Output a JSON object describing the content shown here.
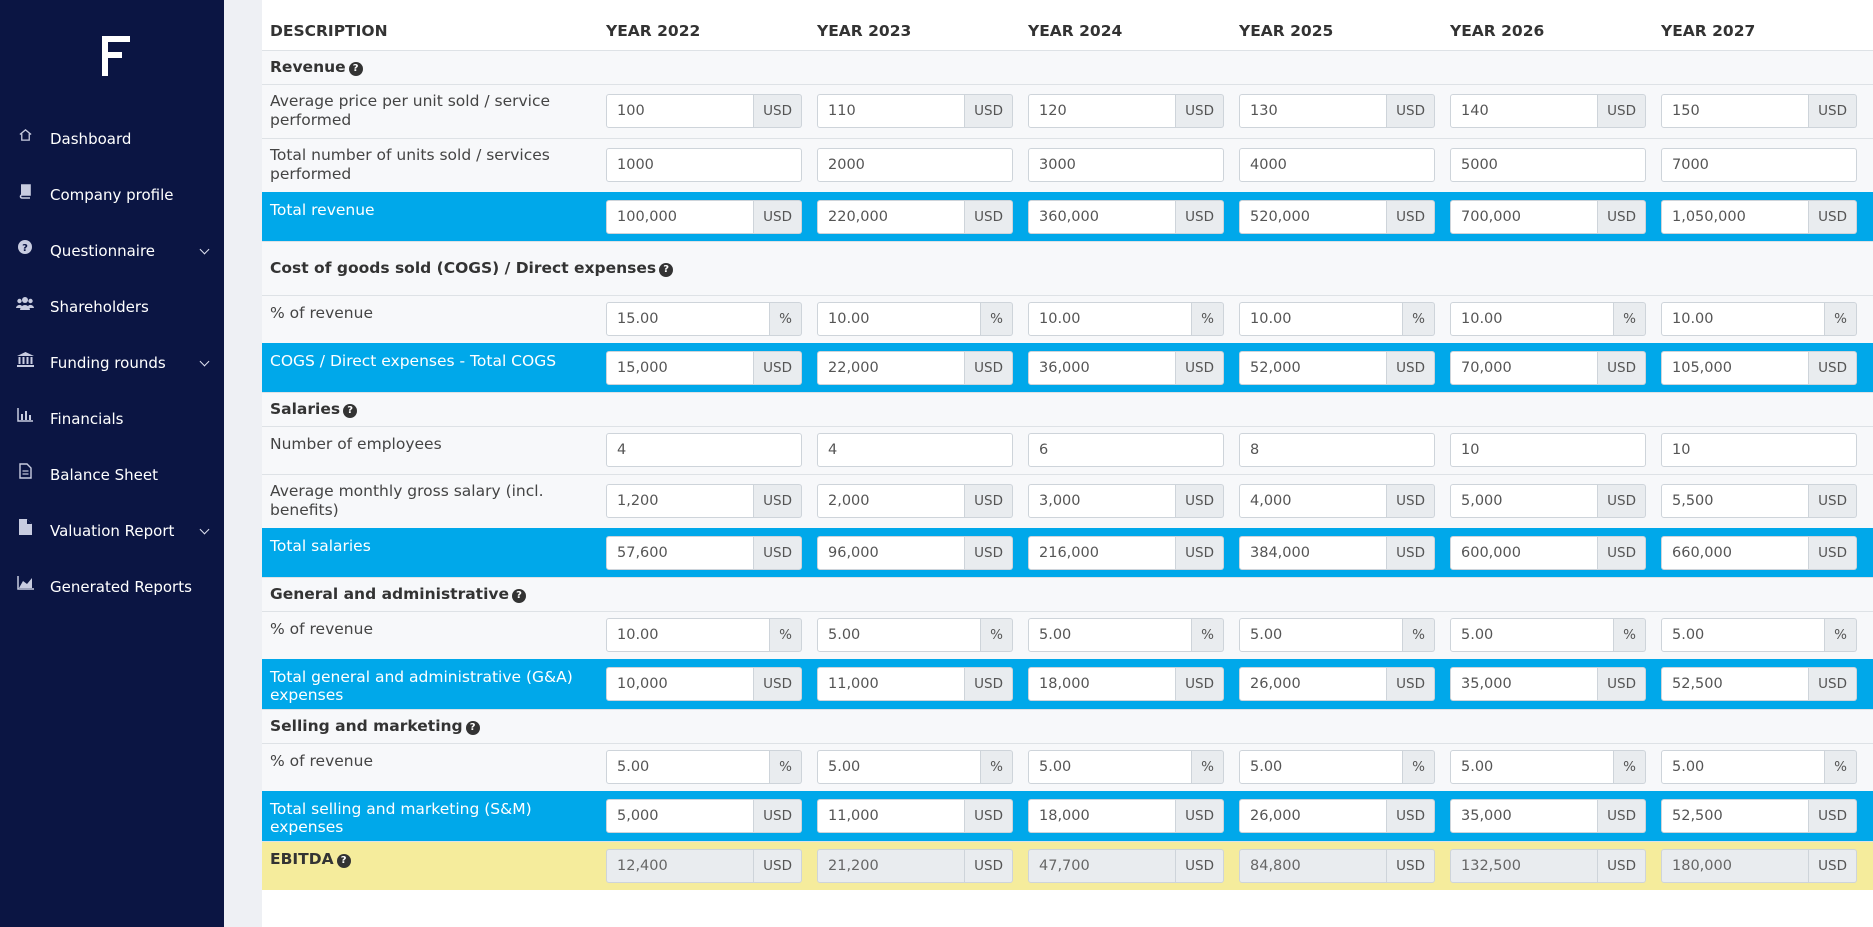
{
  "sidebar": {
    "items": [
      {
        "label": "Dashboard",
        "icon": "home-icon",
        "has_submenu": false
      },
      {
        "label": "Company profile",
        "icon": "book-icon",
        "has_submenu": false
      },
      {
        "label": "Questionnaire",
        "icon": "question-circle-icon",
        "has_submenu": true
      },
      {
        "label": "Shareholders",
        "icon": "users-icon",
        "has_submenu": false
      },
      {
        "label": "Funding rounds",
        "icon": "bank-icon",
        "has_submenu": true
      },
      {
        "label": "Financials",
        "icon": "bar-chart-icon",
        "has_submenu": false
      },
      {
        "label": "Balance Sheet",
        "icon": "document-icon",
        "has_submenu": false
      },
      {
        "label": "Valuation Report",
        "icon": "file-icon",
        "has_submenu": true
      },
      {
        "label": "Generated Reports",
        "icon": "area-chart-icon",
        "has_submenu": false
      }
    ]
  },
  "table": {
    "headers": [
      "DESCRIPTION",
      "YEAR 2022",
      "YEAR 2023",
      "YEAR 2024",
      "YEAR 2025",
      "YEAR 2026",
      "YEAR 2027"
    ],
    "rows": [
      {
        "type": "section",
        "label": "Revenue"
      },
      {
        "type": "input",
        "label": "Average price per unit sold / service performed",
        "unit": "USD",
        "values": [
          "100",
          "110",
          "120",
          "130",
          "140",
          "150"
        ]
      },
      {
        "type": "input",
        "label": "Total number of units sold / services performed",
        "unit": "",
        "values": [
          "1000",
          "2000",
          "3000",
          "4000",
          "5000",
          "7000"
        ]
      },
      {
        "type": "total",
        "label": "Total revenue",
        "unit": "USD",
        "values": [
          "100,000",
          "220,000",
          "360,000",
          "520,000",
          "700,000",
          "1,050,000"
        ]
      },
      {
        "type": "section",
        "label": "Cost of goods sold (COGS) / Direct expenses"
      },
      {
        "type": "input",
        "label": "% of revenue",
        "unit": "%",
        "values": [
          "15.00",
          "10.00",
          "10.00",
          "10.00",
          "10.00",
          "10.00"
        ]
      },
      {
        "type": "total",
        "label": "COGS / Direct expenses - Total COGS",
        "unit": "USD",
        "values": [
          "15,000",
          "22,000",
          "36,000",
          "52,000",
          "70,000",
          "105,000"
        ]
      },
      {
        "type": "section",
        "label": "Salaries"
      },
      {
        "type": "input",
        "label": "Number of employees",
        "unit": "",
        "values": [
          "4",
          "4",
          "6",
          "8",
          "10",
          "10"
        ]
      },
      {
        "type": "input",
        "label": "Average monthly gross salary (incl. benefits)",
        "unit": "USD",
        "values": [
          "1,200",
          "2,000",
          "3,000",
          "4,000",
          "5,000",
          "5,500"
        ]
      },
      {
        "type": "total",
        "label": "Total salaries",
        "unit": "USD",
        "values": [
          "57,600",
          "96,000",
          "216,000",
          "384,000",
          "600,000",
          "660,000"
        ]
      },
      {
        "type": "section",
        "label": "General and administrative"
      },
      {
        "type": "input",
        "label": "% of revenue",
        "unit": "%",
        "values": [
          "10.00",
          "5.00",
          "5.00",
          "5.00",
          "5.00",
          "5.00"
        ]
      },
      {
        "type": "total",
        "label": "Total general and administrative (G&A) expenses",
        "unit": "USD",
        "values": [
          "10,000",
          "11,000",
          "18,000",
          "26,000",
          "35,000",
          "52,500"
        ]
      },
      {
        "type": "section",
        "label": "Selling and marketing"
      },
      {
        "type": "input",
        "label": "% of revenue",
        "unit": "%",
        "values": [
          "5.00",
          "5.00",
          "5.00",
          "5.00",
          "5.00",
          "5.00"
        ]
      },
      {
        "type": "total",
        "label": "Total selling and marketing (S&M) expenses",
        "unit": "USD",
        "values": [
          "5,000",
          "11,000",
          "18,000",
          "26,000",
          "35,000",
          "52,500"
        ]
      },
      {
        "type": "ebitda",
        "label": "EBITDA",
        "unit": "USD",
        "values": [
          "12,400",
          "21,200",
          "47,700",
          "84,800",
          "132,500",
          "180,000"
        ]
      }
    ]
  },
  "colors": {
    "sidebar": "#0b1543",
    "total_row": "#00a8ea",
    "ebitda_row": "#f5ec9c"
  }
}
